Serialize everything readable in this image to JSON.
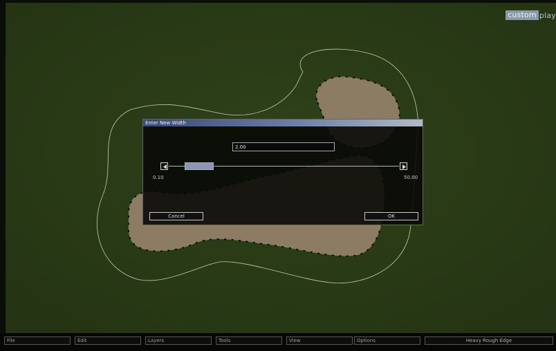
{
  "brand": {
    "part1": "custom",
    "part2": "play"
  },
  "dialog": {
    "title": "Enter New Width",
    "input_value": "2.00",
    "slider": {
      "min_label": "0.10",
      "max_label": "50.00",
      "value": 2.0,
      "min": 0.1,
      "max": 50.0
    },
    "cancel_label": "Cancel",
    "ok_label": "OK"
  },
  "menubar": {
    "items": [
      {
        "label": "File"
      },
      {
        "label": "Edit"
      },
      {
        "label": "Layers"
      },
      {
        "label": "Tools"
      },
      {
        "label": "View"
      },
      {
        "label": "Options"
      }
    ],
    "status": "Heavy Rough Edge"
  },
  "colors": {
    "grass": "#2a3c18",
    "sand": "#8c7c64",
    "dialog_title_gradient_start": "#3a4a72",
    "slider_thumb": "#8c97b6"
  }
}
